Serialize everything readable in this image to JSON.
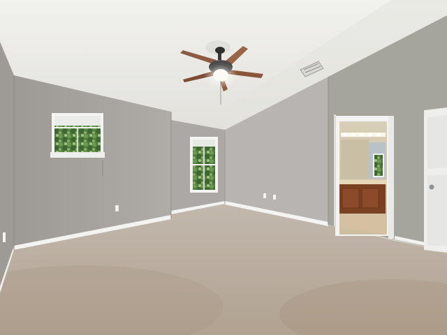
{
  "photo": {
    "subject": "empty-bedroom-interior",
    "palette": {
      "ceiling": "#ecebe6",
      "wall_left": "#a9a6a3",
      "wall_back": "#b4b1ae",
      "wall_right": "#a3a39c",
      "carpet": "#b9ada0",
      "baseboard": "#f2f2f0",
      "fan_blade": "#8e5a40",
      "door": "#eeeeec",
      "vanity": "#7b3f22",
      "window_foliage": "#4f7a3c"
    },
    "icons": [
      "ceiling-fan-icon",
      "air-vent-icon",
      "window-icon",
      "door-icon"
    ]
  }
}
